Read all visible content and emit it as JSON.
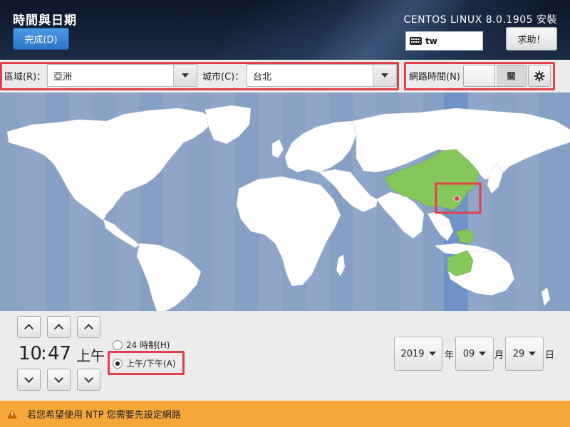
{
  "header": {
    "title": "時間與日期",
    "done_label": "完成(D)",
    "product": "CENTOS LINUX 8.0.1905 安裝",
    "keyboard_layout": "tw",
    "help_label": "求助！"
  },
  "location": {
    "region_label": "區域(R)：",
    "region_value": "亞洲",
    "city_label": "城市(C)：",
    "city_value": "台北"
  },
  "network_time": {
    "label": "網路時間(N)",
    "state_label": "關",
    "enabled": false
  },
  "time": {
    "hours": "10",
    "separator": ":",
    "minutes": "47",
    "ampm": "上午",
    "format_24h_label": "24 時制(H)",
    "format_ampm_label": "上午/下午(A)",
    "selected_format": "ampm"
  },
  "date": {
    "year": "2019",
    "year_unit": "年",
    "month": "09",
    "month_unit": "月",
    "day": "29",
    "day_unit": "日"
  },
  "warning": {
    "text": "若您希望使用 NTP 您需要先設定網路"
  },
  "icons": {
    "keyboard": "keyboard-icon",
    "gear": "gear-icon",
    "warning": "warning-icon",
    "up": "chevron-up-icon",
    "down": "chevron-down-icon"
  },
  "colors": {
    "map_ocean": "#8fa6c8",
    "selected_zone": "#6f93c7",
    "selected_region": "#86c75b",
    "highlight": "#e0404a",
    "warning_bar": "#f6a73a",
    "done_button": "#3a84d6"
  }
}
